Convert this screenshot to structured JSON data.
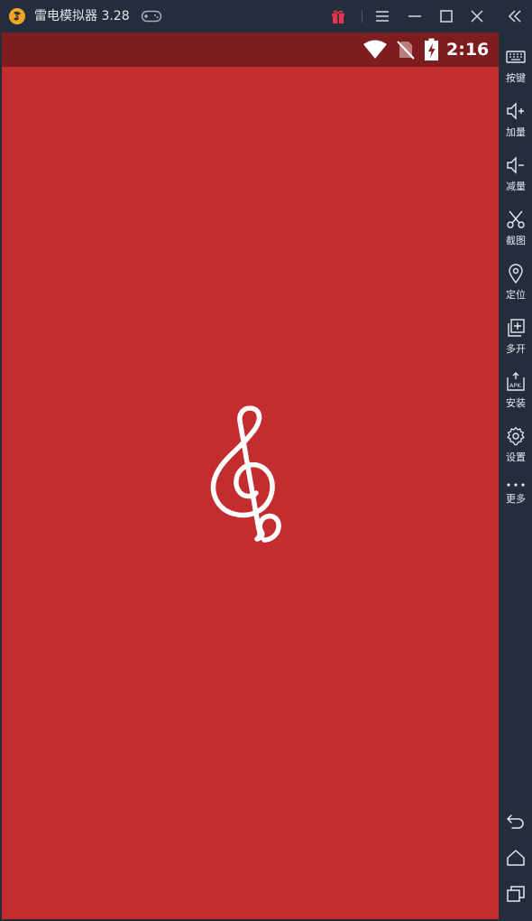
{
  "window": {
    "title": "雷电模拟器 3.28",
    "logo_icon": "ldplayer-logo-icon",
    "controls": [
      "gamepad-icon",
      "gift-icon",
      "menu-icon",
      "minimize-icon",
      "maximize-icon",
      "close-icon",
      "collapse-sidebar-icon"
    ],
    "accent_logo": "#f5a623",
    "gift_color": "#e8334a"
  },
  "statusbar": {
    "time": "2:16",
    "icons": [
      "wifi-icon",
      "no-sim-icon",
      "battery-charging-icon"
    ]
  },
  "screen": {
    "background": "#c32d2f",
    "statusbar_background": "#7e1d1f",
    "splash_icon": "treble-clef-icon"
  },
  "sidebar": {
    "items": [
      {
        "label": "按键",
        "icon": "keyboard-icon"
      },
      {
        "label": "加量",
        "icon": "volume-up-icon"
      },
      {
        "label": "减量",
        "icon": "volume-down-icon"
      },
      {
        "label": "截图",
        "icon": "scissors-icon"
      },
      {
        "label": "定位",
        "icon": "location-pin-icon"
      },
      {
        "label": "多开",
        "icon": "multi-instance-icon"
      },
      {
        "label": "安装",
        "icon": "apk-install-icon"
      },
      {
        "label": "设置",
        "icon": "gear-icon"
      },
      {
        "label": "更多",
        "icon": "more-dots-icon"
      }
    ],
    "nav": [
      "back-icon",
      "home-icon",
      "recent-apps-icon"
    ]
  }
}
